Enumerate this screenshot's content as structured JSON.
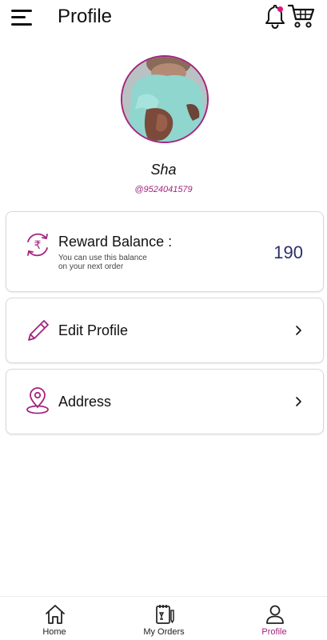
{
  "header": {
    "title": "Profile",
    "menu_icon": "hamburger-icon",
    "bell_icon": "bell-icon",
    "cart_icon": "cart-icon"
  },
  "profile": {
    "name": "Sha",
    "phone": "@9524041579"
  },
  "reward": {
    "icon": "rupee-refresh-icon",
    "title": "Reward Balance :",
    "subtitle_line1": "You can use this balance",
    "subtitle_line2": "on your next order",
    "value": "190"
  },
  "menu": {
    "edit_profile": {
      "label": "Edit Profile",
      "icon": "pencil-icon"
    },
    "address": {
      "label": "Address",
      "icon": "location-pin-icon"
    }
  },
  "bottom_nav": {
    "items": [
      {
        "label": "Home",
        "icon": "home-icon",
        "active": false
      },
      {
        "label": "My Orders",
        "icon": "orders-icon",
        "active": false
      },
      {
        "label": "Profile",
        "icon": "user-icon",
        "active": true
      }
    ]
  },
  "colors": {
    "accent": "#a3247e",
    "notification_dot": "#e0157d",
    "reward_value": "#2a2f6b"
  }
}
